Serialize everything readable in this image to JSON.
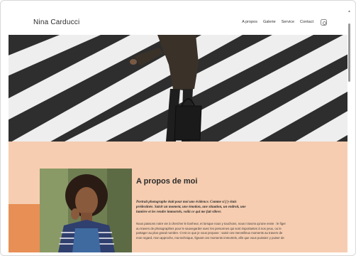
{
  "site": {
    "brand": "Nina Carducci"
  },
  "nav": {
    "items": [
      "A propos",
      "Galerie",
      "Service",
      "Contact"
    ],
    "instagram_icon": "instagram-icon"
  },
  "about": {
    "title": "A propos de moi",
    "lead": "Portrait photographe était pour moi une évidence. Comme si j'y étais prédestinée. Saisir un moment, une émotion, une situation, un endroit, une lumière et les rendre immortels, voilà ce qui me fait vibrer.",
    "body": "Nous passons notre vie à chercher le bonheur, et lorsque nous y touchons, nous n'avons qu'une envie : le figer au travers de photographies pour le sauvegarder avec les personnes qui sont importantes à nos yeux, ou le partager au plus grand nombre. C'est ce que je vous propose : saisir ces merveilleux moments au travers de mon regard, mon approche, ma technique, figeant ces moments immortels, afin que vous puissiez y puiser de"
  },
  "colors": {
    "section_bg": "#f6cdb0",
    "accent": "#e88f55"
  }
}
